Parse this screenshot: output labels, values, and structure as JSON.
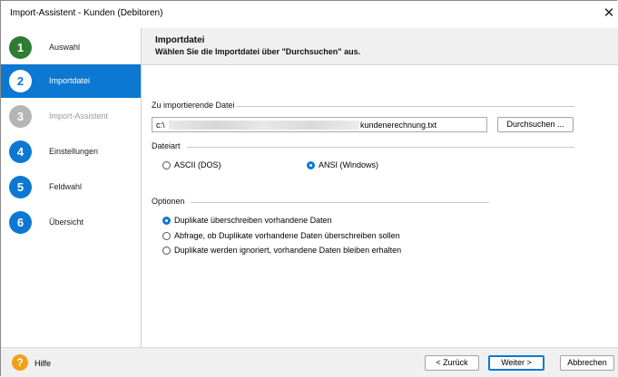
{
  "window": {
    "title": "Import-Assistent - Kunden (Debitoren)",
    "close_glyph": "✕"
  },
  "steps": [
    {
      "num": "1",
      "label": "Auswahl",
      "state": "done"
    },
    {
      "num": "2",
      "label": "Importdatei",
      "state": "active"
    },
    {
      "num": "3",
      "label": "Import-Assistent",
      "state": "disabled"
    },
    {
      "num": "4",
      "label": "Einstellungen",
      "state": "todo"
    },
    {
      "num": "5",
      "label": "Feldwahl",
      "state": "todo"
    },
    {
      "num": "6",
      "label": "Übersicht",
      "state": "todo"
    }
  ],
  "header": {
    "title": "Importdatei",
    "subtitle": "Wählen Sie die Importdatei über \"Durchsuchen\" aus."
  },
  "file_group": {
    "label": "Zu importierende Datei",
    "prefix": "c:\\",
    "filename": "kundenerechnung.txt",
    "browse_label": "Durchsuchen ..."
  },
  "encoding_group": {
    "label": "Dateiart",
    "options": [
      {
        "label": "ASCII (DOS)",
        "checked": false
      },
      {
        "label": "ANSI (Windows)",
        "checked": true
      }
    ]
  },
  "options_group": {
    "label": "Optionen",
    "options": [
      {
        "label": "Duplikate überschreiben vorhandene Daten",
        "checked": true
      },
      {
        "label": "Abfrage, ob Duplikate vorhandene Daten überschreiben sollen",
        "checked": false
      },
      {
        "label": "Duplikate werden ignoriert, vorhandene Daten bleiben erhalten",
        "checked": false
      }
    ]
  },
  "footer": {
    "help_glyph": "?",
    "help_label": "Hilfe",
    "back_label": "< Zurück",
    "next_label": "Weiter >",
    "cancel_label": "Abbrechen"
  },
  "colors": {
    "accent": "#0d78d1",
    "done": "#2e7d32",
    "disabled": "#b5b5b5",
    "help": "#f2a01b"
  }
}
